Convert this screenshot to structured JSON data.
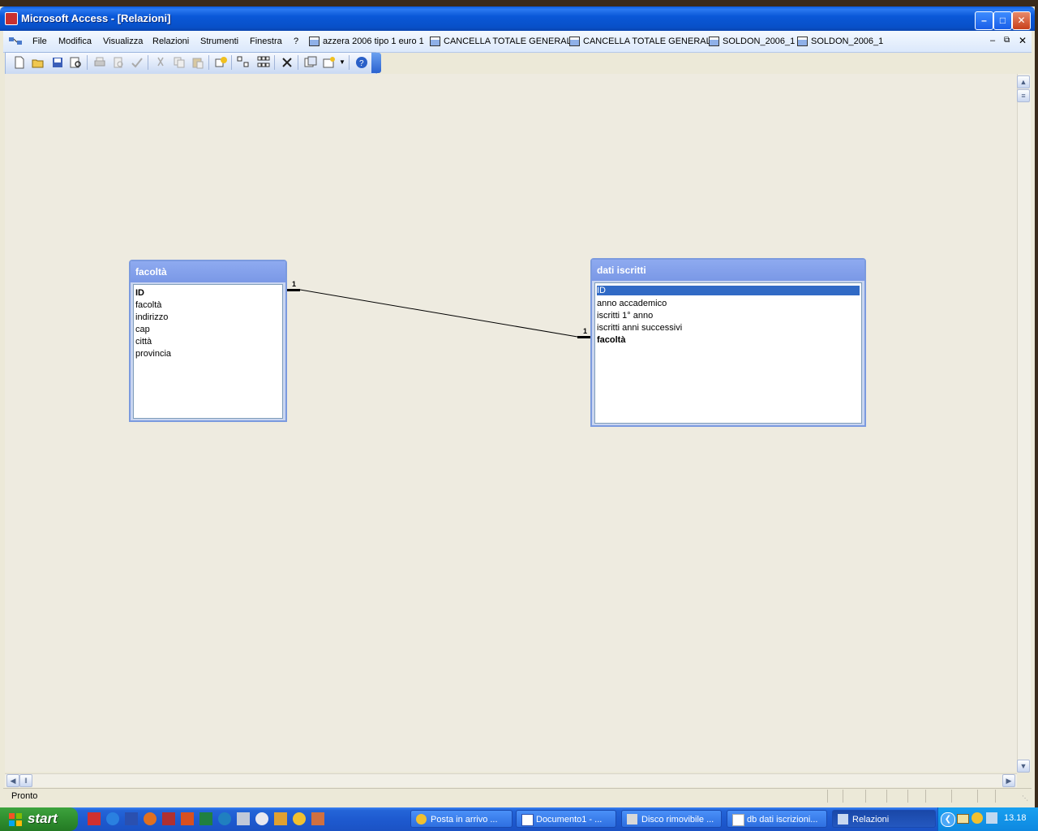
{
  "window": {
    "title": "Microsoft Access - [Relazioni]"
  },
  "menu": {
    "items": [
      "File",
      "Modifica",
      "Visualizza",
      "Relazioni",
      "Strumenti",
      "Finestra",
      "?"
    ],
    "quick_items": [
      "azzera 2006 tipo 1 euro 1",
      "CANCELLA TOTALE GENERALE",
      "CANCELLA TOTALE GENERALE",
      "SOLDON_2006_1",
      "SOLDON_2006_1"
    ]
  },
  "tables": {
    "facolta": {
      "title": "facoltà",
      "fields": [
        "ID",
        "facoltà",
        "indirizzo",
        "cap",
        "città",
        "provincia"
      ]
    },
    "dati_iscritti": {
      "title": "dati iscritti",
      "fields": [
        "ID",
        "anno accademico",
        "iscritti 1° anno",
        "iscritti anni successivi",
        "facoltà"
      ]
    }
  },
  "relationship": {
    "left_cardinality": "1",
    "right_cardinality": "1"
  },
  "status": {
    "text": "Pronto"
  },
  "taskbar": {
    "start_label": "start",
    "tasks": [
      "Posta in arrivo ...",
      "Documento1 - ...",
      "Disco rimovibile ...",
      "db dati iscrizioni...",
      "Relazioni"
    ],
    "clock": "13.18"
  },
  "colors": {
    "title_blue": "#0a58d8",
    "workspace": "#eeebe0",
    "table_header": "#7a98e6",
    "selection": "#316ac5",
    "start_green": "#2d8a2d"
  }
}
